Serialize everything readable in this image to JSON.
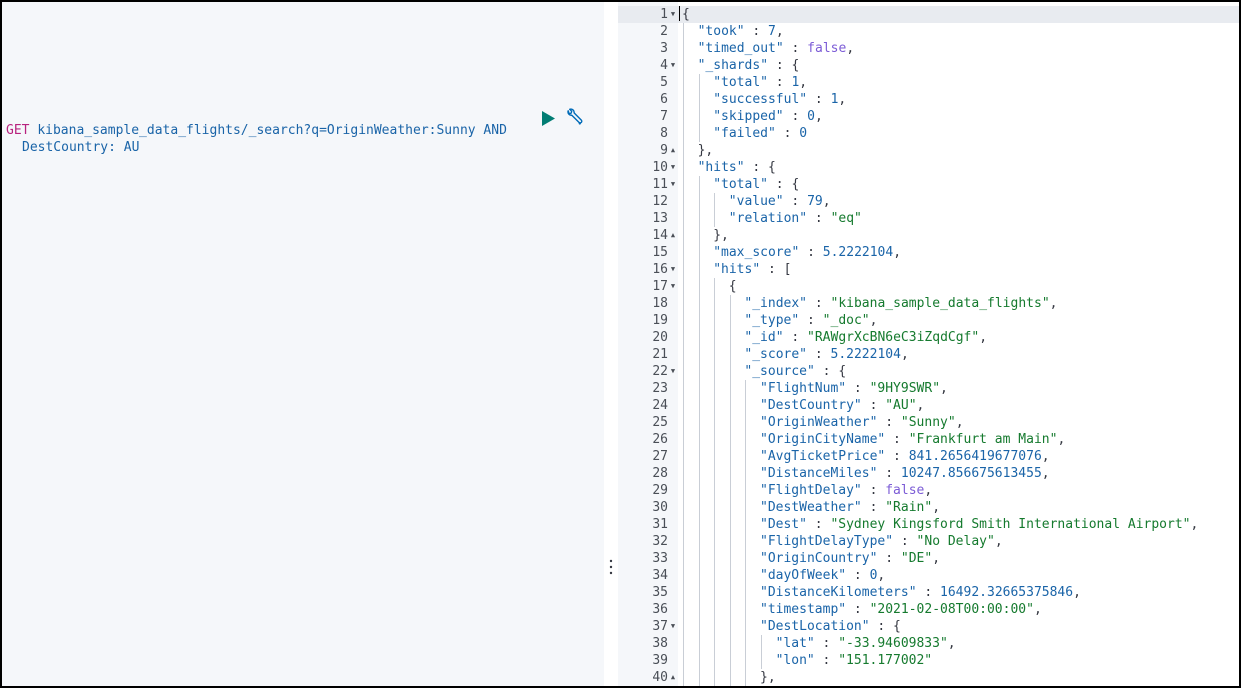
{
  "request": {
    "method": "GET",
    "url_line1": "kibana_sample_data_flights/_search?q=OriginWeather:Sunny AND",
    "url_line2": "DestCountry: AU"
  },
  "toolbar": {
    "play_icon": "play-icon",
    "wrench_icon": "wrench-icon"
  },
  "colors": {
    "key": "#1a64a8",
    "string": "#157a2e",
    "number": "#1a64a8",
    "boolean": "#7c5cd6",
    "method": "#b8227e"
  },
  "response": {
    "lines": [
      {
        "n": "1",
        "fold": "down",
        "t": [
          [
            "p",
            "{"
          ]
        ]
      },
      {
        "n": "2",
        "t": [
          [
            "k",
            "\"took\""
          ],
          [
            "p",
            " : "
          ],
          [
            "n",
            "7"
          ],
          [
            "p",
            ","
          ]
        ]
      },
      {
        "n": "3",
        "t": [
          [
            "k",
            "\"timed_out\""
          ],
          [
            "p",
            " : "
          ],
          [
            "b",
            "false"
          ],
          [
            "p",
            ","
          ]
        ]
      },
      {
        "n": "4",
        "fold": "down",
        "t": [
          [
            "k",
            "\"_shards\""
          ],
          [
            "p",
            " : {"
          ]
        ]
      },
      {
        "n": "5",
        "t": [
          [
            "k",
            "\"total\""
          ],
          [
            "p",
            " : "
          ],
          [
            "n",
            "1"
          ],
          [
            "p",
            ","
          ]
        ]
      },
      {
        "n": "6",
        "t": [
          [
            "k",
            "\"successful\""
          ],
          [
            "p",
            " : "
          ],
          [
            "n",
            "1"
          ],
          [
            "p",
            ","
          ]
        ]
      },
      {
        "n": "7",
        "t": [
          [
            "k",
            "\"skipped\""
          ],
          [
            "p",
            " : "
          ],
          [
            "n",
            "0"
          ],
          [
            "p",
            ","
          ]
        ]
      },
      {
        "n": "8",
        "t": [
          [
            "k",
            "\"failed\""
          ],
          [
            "p",
            " : "
          ],
          [
            "n",
            "0"
          ]
        ]
      },
      {
        "n": "9",
        "fold": "up",
        "t": [
          [
            "p",
            "},"
          ]
        ]
      },
      {
        "n": "10",
        "fold": "down",
        "t": [
          [
            "k",
            "\"hits\""
          ],
          [
            "p",
            " : {"
          ]
        ]
      },
      {
        "n": "11",
        "fold": "down",
        "t": [
          [
            "k",
            "\"total\""
          ],
          [
            "p",
            " : {"
          ]
        ]
      },
      {
        "n": "12",
        "t": [
          [
            "k",
            "\"value\""
          ],
          [
            "p",
            " : "
          ],
          [
            "n",
            "79"
          ],
          [
            "p",
            ","
          ]
        ]
      },
      {
        "n": "13",
        "t": [
          [
            "k",
            "\"relation\""
          ],
          [
            "p",
            " : "
          ],
          [
            "s",
            "\"eq\""
          ]
        ]
      },
      {
        "n": "14",
        "fold": "up",
        "t": [
          [
            "p",
            "},"
          ]
        ]
      },
      {
        "n": "15",
        "t": [
          [
            "k",
            "\"max_score\""
          ],
          [
            "p",
            " : "
          ],
          [
            "n",
            "5.2222104"
          ],
          [
            "p",
            ","
          ]
        ]
      },
      {
        "n": "16",
        "fold": "down",
        "t": [
          [
            "k",
            "\"hits\""
          ],
          [
            "p",
            " : ["
          ]
        ]
      },
      {
        "n": "17",
        "fold": "down",
        "t": [
          [
            "p",
            "{"
          ]
        ]
      },
      {
        "n": "18",
        "t": [
          [
            "k",
            "\"_index\""
          ],
          [
            "p",
            " : "
          ],
          [
            "s",
            "\"kibana_sample_data_flights\""
          ],
          [
            "p",
            ","
          ]
        ]
      },
      {
        "n": "19",
        "t": [
          [
            "k",
            "\"_type\""
          ],
          [
            "p",
            " : "
          ],
          [
            "s",
            "\"_doc\""
          ],
          [
            "p",
            ","
          ]
        ]
      },
      {
        "n": "20",
        "t": [
          [
            "k",
            "\"_id\""
          ],
          [
            "p",
            " : "
          ],
          [
            "s",
            "\"RAWgrXcBN6eC3iZqdCgf\""
          ],
          [
            "p",
            ","
          ]
        ]
      },
      {
        "n": "21",
        "t": [
          [
            "k",
            "\"_score\""
          ],
          [
            "p",
            " : "
          ],
          [
            "n",
            "5.2222104"
          ],
          [
            "p",
            ","
          ]
        ]
      },
      {
        "n": "22",
        "fold": "down",
        "t": [
          [
            "k",
            "\"_source\""
          ],
          [
            "p",
            " : {"
          ]
        ]
      },
      {
        "n": "23",
        "t": [
          [
            "k",
            "\"FlightNum\""
          ],
          [
            "p",
            " : "
          ],
          [
            "s",
            "\"9HY9SWR\""
          ],
          [
            "p",
            ","
          ]
        ]
      },
      {
        "n": "24",
        "t": [
          [
            "k",
            "\"DestCountry\""
          ],
          [
            "p",
            " : "
          ],
          [
            "s",
            "\"AU\""
          ],
          [
            "p",
            ","
          ]
        ]
      },
      {
        "n": "25",
        "t": [
          [
            "k",
            "\"OriginWeather\""
          ],
          [
            "p",
            " : "
          ],
          [
            "s",
            "\"Sunny\""
          ],
          [
            "p",
            ","
          ]
        ]
      },
      {
        "n": "26",
        "t": [
          [
            "k",
            "\"OriginCityName\""
          ],
          [
            "p",
            " : "
          ],
          [
            "s",
            "\"Frankfurt am Main\""
          ],
          [
            "p",
            ","
          ]
        ]
      },
      {
        "n": "27",
        "t": [
          [
            "k",
            "\"AvgTicketPrice\""
          ],
          [
            "p",
            " : "
          ],
          [
            "n",
            "841.2656419677076"
          ],
          [
            "p",
            ","
          ]
        ]
      },
      {
        "n": "28",
        "t": [
          [
            "k",
            "\"DistanceMiles\""
          ],
          [
            "p",
            " : "
          ],
          [
            "n",
            "10247.856675613455"
          ],
          [
            "p",
            ","
          ]
        ]
      },
      {
        "n": "29",
        "t": [
          [
            "k",
            "\"FlightDelay\""
          ],
          [
            "p",
            " : "
          ],
          [
            "b",
            "false"
          ],
          [
            "p",
            ","
          ]
        ]
      },
      {
        "n": "30",
        "t": [
          [
            "k",
            "\"DestWeather\""
          ],
          [
            "p",
            " : "
          ],
          [
            "s",
            "\"Rain\""
          ],
          [
            "p",
            ","
          ]
        ]
      },
      {
        "n": "31",
        "t": [
          [
            "k",
            "\"Dest\""
          ],
          [
            "p",
            " : "
          ],
          [
            "s",
            "\"Sydney Kingsford Smith International Airport\""
          ],
          [
            "p",
            ","
          ]
        ]
      },
      {
        "n": "32",
        "t": [
          [
            "k",
            "\"FlightDelayType\""
          ],
          [
            "p",
            " : "
          ],
          [
            "s",
            "\"No Delay\""
          ],
          [
            "p",
            ","
          ]
        ]
      },
      {
        "n": "33",
        "t": [
          [
            "k",
            "\"OriginCountry\""
          ],
          [
            "p",
            " : "
          ],
          [
            "s",
            "\"DE\""
          ],
          [
            "p",
            ","
          ]
        ]
      },
      {
        "n": "34",
        "t": [
          [
            "k",
            "\"dayOfWeek\""
          ],
          [
            "p",
            " : "
          ],
          [
            "n",
            "0"
          ],
          [
            "p",
            ","
          ]
        ]
      },
      {
        "n": "35",
        "t": [
          [
            "k",
            "\"DistanceKilometers\""
          ],
          [
            "p",
            " : "
          ],
          [
            "n",
            "16492.32665375846"
          ],
          [
            "p",
            ","
          ]
        ]
      },
      {
        "n": "36",
        "t": [
          [
            "k",
            "\"timestamp\""
          ],
          [
            "p",
            " : "
          ],
          [
            "s",
            "\"2021-02-08T00:00:00\""
          ],
          [
            "p",
            ","
          ]
        ]
      },
      {
        "n": "37",
        "fold": "down",
        "t": [
          [
            "k",
            "\"DestLocation\""
          ],
          [
            "p",
            " : {"
          ]
        ]
      },
      {
        "n": "38",
        "t": [
          [
            "k",
            "\"lat\""
          ],
          [
            "p",
            " : "
          ],
          [
            "s",
            "\"-33.94609833\""
          ],
          [
            "p",
            ","
          ]
        ]
      },
      {
        "n": "39",
        "t": [
          [
            "k",
            "\"lon\""
          ],
          [
            "p",
            " : "
          ],
          [
            "s",
            "\"151.177002\""
          ]
        ]
      },
      {
        "n": "40",
        "fold": "up",
        "t": [
          [
            "p",
            "},"
          ]
        ]
      }
    ]
  }
}
